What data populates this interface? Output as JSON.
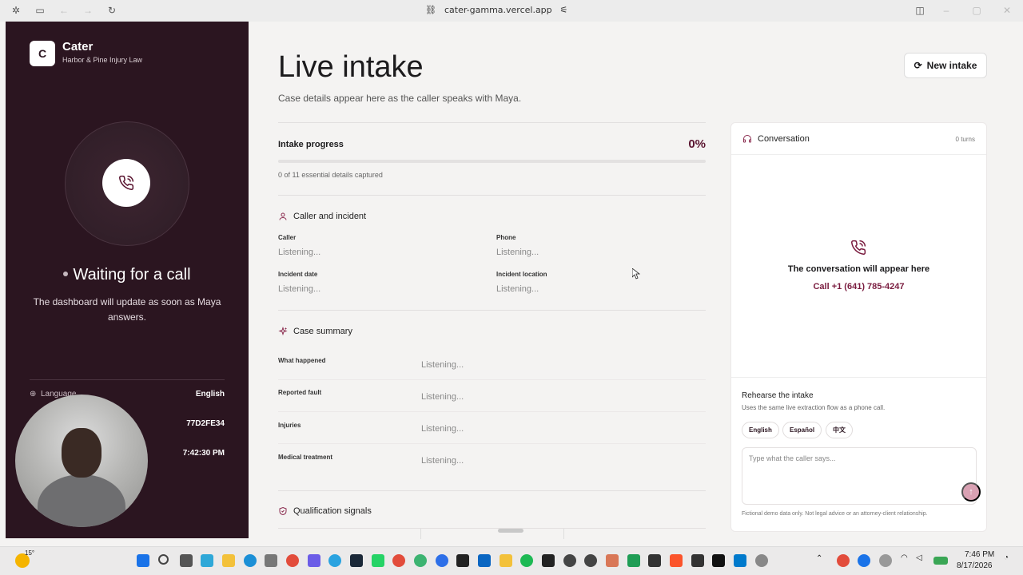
{
  "browser": {
    "url": "cater-gamma.vercel.app"
  },
  "sidebar": {
    "logo_letter": "C",
    "brand_name": "Cater",
    "firm_name": "Harbor & Pine Injury Law",
    "status_title": "Waiting for a call",
    "status_text": "The dashboard will update as soon as Maya answers.",
    "info": [
      {
        "label": "Language",
        "value": "English"
      },
      {
        "label": "",
        "value": "77D2FE34"
      },
      {
        "label": "",
        "value": "7:42:30 PM"
      }
    ]
  },
  "main": {
    "title": "Live intake",
    "subtitle": "Case details appear here as the caller speaks with Maya.",
    "new_intake_label": "New intake",
    "progress": {
      "title": "Intake progress",
      "percent_label": "0%",
      "fraction": 0,
      "count_text": "0 of 11 essential details captured"
    },
    "caller_section": {
      "title": "Caller and incident",
      "fields": [
        {
          "label": "Caller",
          "value": "Listening..."
        },
        {
          "label": "Phone",
          "value": "Listening..."
        },
        {
          "label": "Incident date",
          "value": "Listening..."
        },
        {
          "label": "Incident location",
          "value": "Listening..."
        }
      ]
    },
    "summary_section": {
      "title": "Case summary",
      "rows": [
        {
          "label": "What happened",
          "value": "Listening..."
        },
        {
          "label": "Reported fault",
          "value": "Listening..."
        },
        {
          "label": "Injuries",
          "value": "Listening..."
        },
        {
          "label": "Medical treatment",
          "value": "Listening..."
        }
      ]
    },
    "qualification_section": {
      "title": "Qualification signals"
    }
  },
  "conversation": {
    "title": "Conversation",
    "turns": "0 turns",
    "empty_title": "The conversation will appear here",
    "empty_call": "Call +1 (641) 785-4247",
    "rehearse": {
      "title": "Rehearse the intake",
      "subtitle": "Uses the same live extraction flow as a phone call.",
      "languages": [
        "English",
        "Español",
        "中文"
      ],
      "input_placeholder": "Type what the caller says...",
      "footer": "Fictional demo data only. Not legal advice or an attorney-client relationship."
    }
  },
  "taskbar": {
    "weather": "15°",
    "time": "7:46 PM",
    "date": "8/17/2026"
  },
  "colors": {
    "sidebar_bg": "#2b1520",
    "accent": "#5a1530",
    "call_link": "#7a1c3f"
  }
}
